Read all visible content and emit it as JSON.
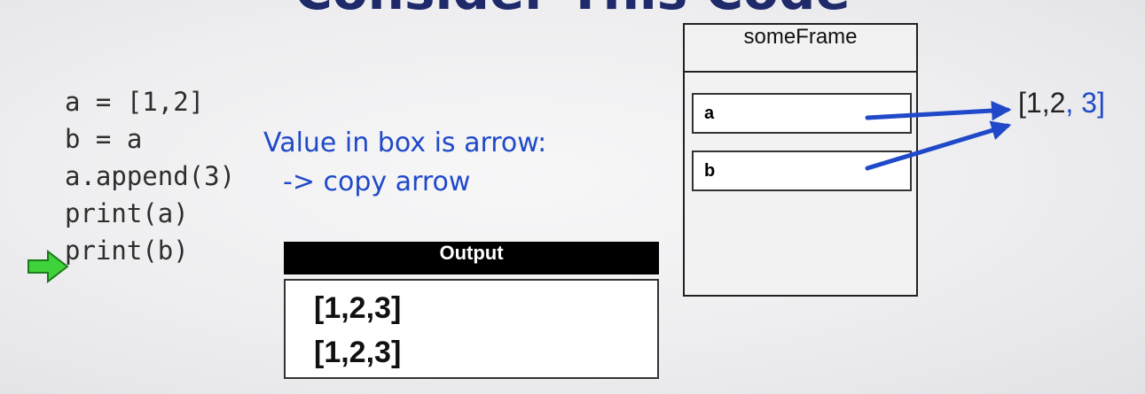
{
  "title": "Consider This Code",
  "code_lines": [
    "a = [1,2]",
    "b = a",
    "a.append(3)",
    "print(a)",
    "print(b)"
  ],
  "note": {
    "line1": "Value in box is arrow:",
    "line2": "-> copy arrow"
  },
  "output": {
    "header": "Output",
    "lines": [
      "[1,2,3]",
      "[1,2,3]"
    ]
  },
  "frame": {
    "title": "someFrame",
    "variables": [
      "a",
      "b"
    ]
  },
  "list_value": {
    "part1": "[1,2",
    "part2": ", 3]"
  },
  "colors": {
    "title": "#1f2a6b",
    "accent_blue": "#1f49c9",
    "exec_arrow": "#3fd23a"
  }
}
